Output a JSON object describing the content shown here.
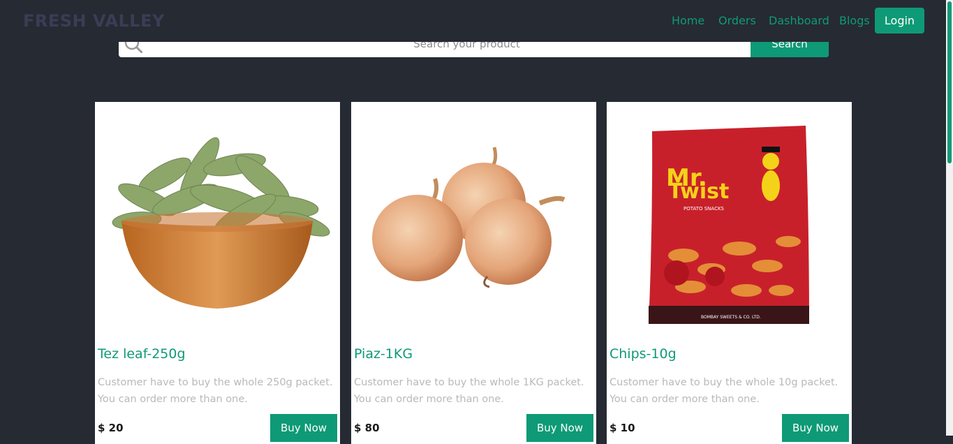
{
  "navbar": {
    "brand": "FRESH VALLEY",
    "links": [
      "Home",
      "Orders",
      "Dashboard",
      "Blogs"
    ],
    "login_label": "Login"
  },
  "search": {
    "placeholder": "Search your product",
    "button_label": "Search"
  },
  "products": [
    {
      "title": "Tez leaf-250g",
      "description": "Customer have to buy the whole 250g packet. You can order more than one.",
      "price": "$ 20",
      "button_label": "Buy Now"
    },
    {
      "title": "Piaz-1KG",
      "description": "Customer have to buy the whole 1KG packet. You can order more than one.",
      "price": "$ 80",
      "button_label": "Buy Now"
    },
    {
      "title": "Chips-10g",
      "description": "Customer have to buy the whole 10g packet. You can order more than one.",
      "price": "$ 10",
      "button_label": "Buy Now"
    }
  ],
  "image_text": {
    "chips_brand_line1": "Mr.",
    "chips_brand_line2": "Twist",
    "chips_sub": "POTATO SNACKS",
    "chips_maker": "BOMBAY SWEETS & CO. LTD."
  },
  "colors": {
    "accent": "#0e9a76",
    "background": "#262a33",
    "brand_text": "#3a3d54"
  }
}
